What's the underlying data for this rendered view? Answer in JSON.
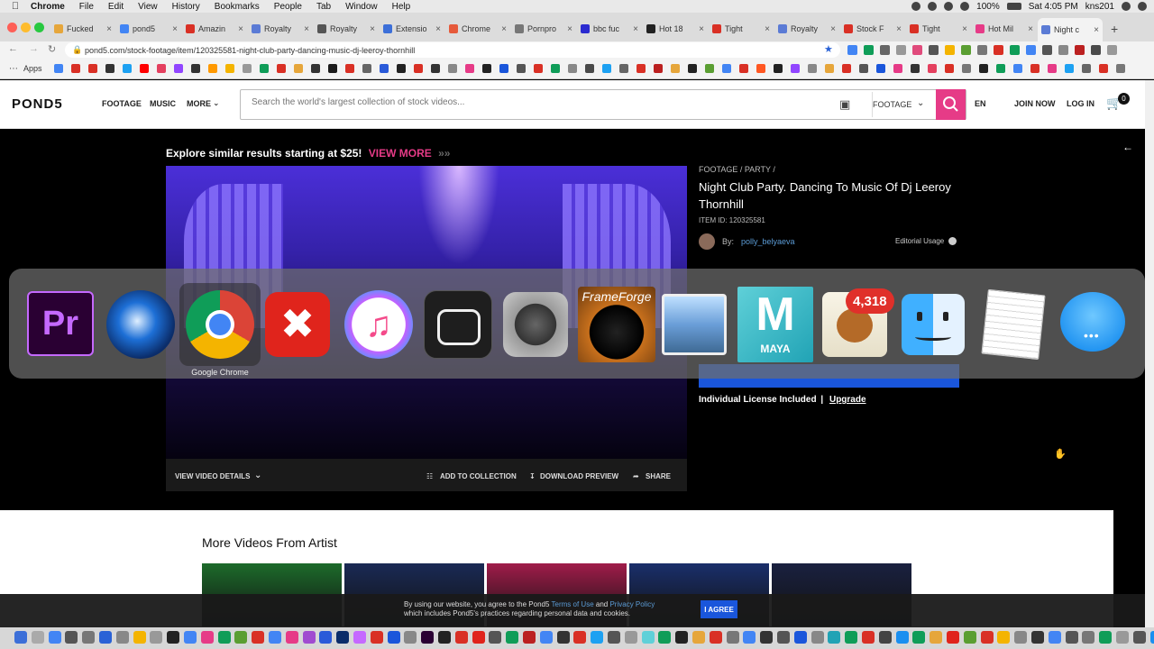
{
  "menubar": {
    "app": "Chrome",
    "items": [
      "File",
      "Edit",
      "View",
      "History",
      "Bookmarks",
      "People",
      "Tab",
      "Window",
      "Help"
    ],
    "battery": "100%",
    "clock": "Sat 4:05 PM",
    "user": "kns201"
  },
  "tabs": [
    {
      "label": "Fucked",
      "color": "#e6a63b"
    },
    {
      "label": "pond5",
      "color": "#4285f4"
    },
    {
      "label": "Amazin",
      "color": "#d93025"
    },
    {
      "label": "Royalty",
      "color": "#5b7bd5"
    },
    {
      "label": "Royalty",
      "color": "#555555"
    },
    {
      "label": "Extensio",
      "color": "#3c6fd8"
    },
    {
      "label": "Chrome",
      "color": "#e65a3b"
    },
    {
      "label": "Pornpro",
      "color": "#777777"
    },
    {
      "label": "bbc fuc",
      "color": "#2b2bd0"
    },
    {
      "label": "Hot 18",
      "color": "#222222"
    },
    {
      "label": "Tight",
      "color": "#d93025"
    },
    {
      "label": "Royalty",
      "color": "#5b7bd5"
    },
    {
      "label": "Stock F",
      "color": "#d93025"
    },
    {
      "label": "Tight",
      "color": "#d93025"
    },
    {
      "label": "Hot Mil",
      "color": "#e63b87"
    },
    {
      "label": "Night c",
      "color": "#5b7bd5"
    }
  ],
  "address": {
    "url": "pond5.com/stock-footage/item/120325581-night-club-party-dancing-music-dj-leeroy-thornhill"
  },
  "bookmarks": {
    "apps_label": "Apps"
  },
  "header": {
    "logo": "POND5",
    "nav": [
      "FOOTAGE",
      "MUSIC",
      "MORE"
    ],
    "search_placeholder": "Search the world's largest collection of stock videos...",
    "search_category": "FOOTAGE",
    "language": "EN",
    "join": "JOIN NOW",
    "login": "LOG IN",
    "cart_count": "0"
  },
  "explore": {
    "text": "Explore similar results starting at $25!",
    "link": "VIEW MORE"
  },
  "player": {
    "details": "VIEW VIDEO DETAILS",
    "add_collection": "ADD TO COLLECTION",
    "download_preview": "DOWNLOAD PREVIEW",
    "share": "SHARE"
  },
  "item": {
    "breadcrumb": "FOOTAGE / PARTY /",
    "title": "Night Club Party. Dancing To Music Of Dj Leeroy Thornhill",
    "item_id": "ITEM ID: 120325581",
    "by_label": "By:",
    "artist": "polly_belyaeva",
    "editorial": "Editorial Usage",
    "license_text": "Individual License Included",
    "upgrade": "Upgrade"
  },
  "more_videos": {
    "title": "More Videos From Artist",
    "thumb_colors": [
      "#1d6b2b",
      "#1a2a55",
      "#a01c4a",
      "#1a2f6b",
      "#1a2140"
    ]
  },
  "cookie": {
    "text_1": "By using our website, you agree to the Pond5",
    "terms": "Terms of Use",
    "and": "and",
    "privacy": "Privacy Policy",
    "text_2": "which includes Pond5's practices regarding personal data and cookies.",
    "button": "I AGREE"
  },
  "switcher": {
    "selected_label": "Google Chrome",
    "mail_badge": "4,318",
    "framefor_label": "FrameForge",
    "maya_label": "MAYA",
    "apps": [
      "premiere-pro",
      "quicktime",
      "google-chrome",
      "xmind",
      "itunes",
      "bettertouchtool",
      "system-preferences",
      "frameforge",
      "preview",
      "maya",
      "mail",
      "finder",
      "textedit",
      "messages"
    ]
  }
}
